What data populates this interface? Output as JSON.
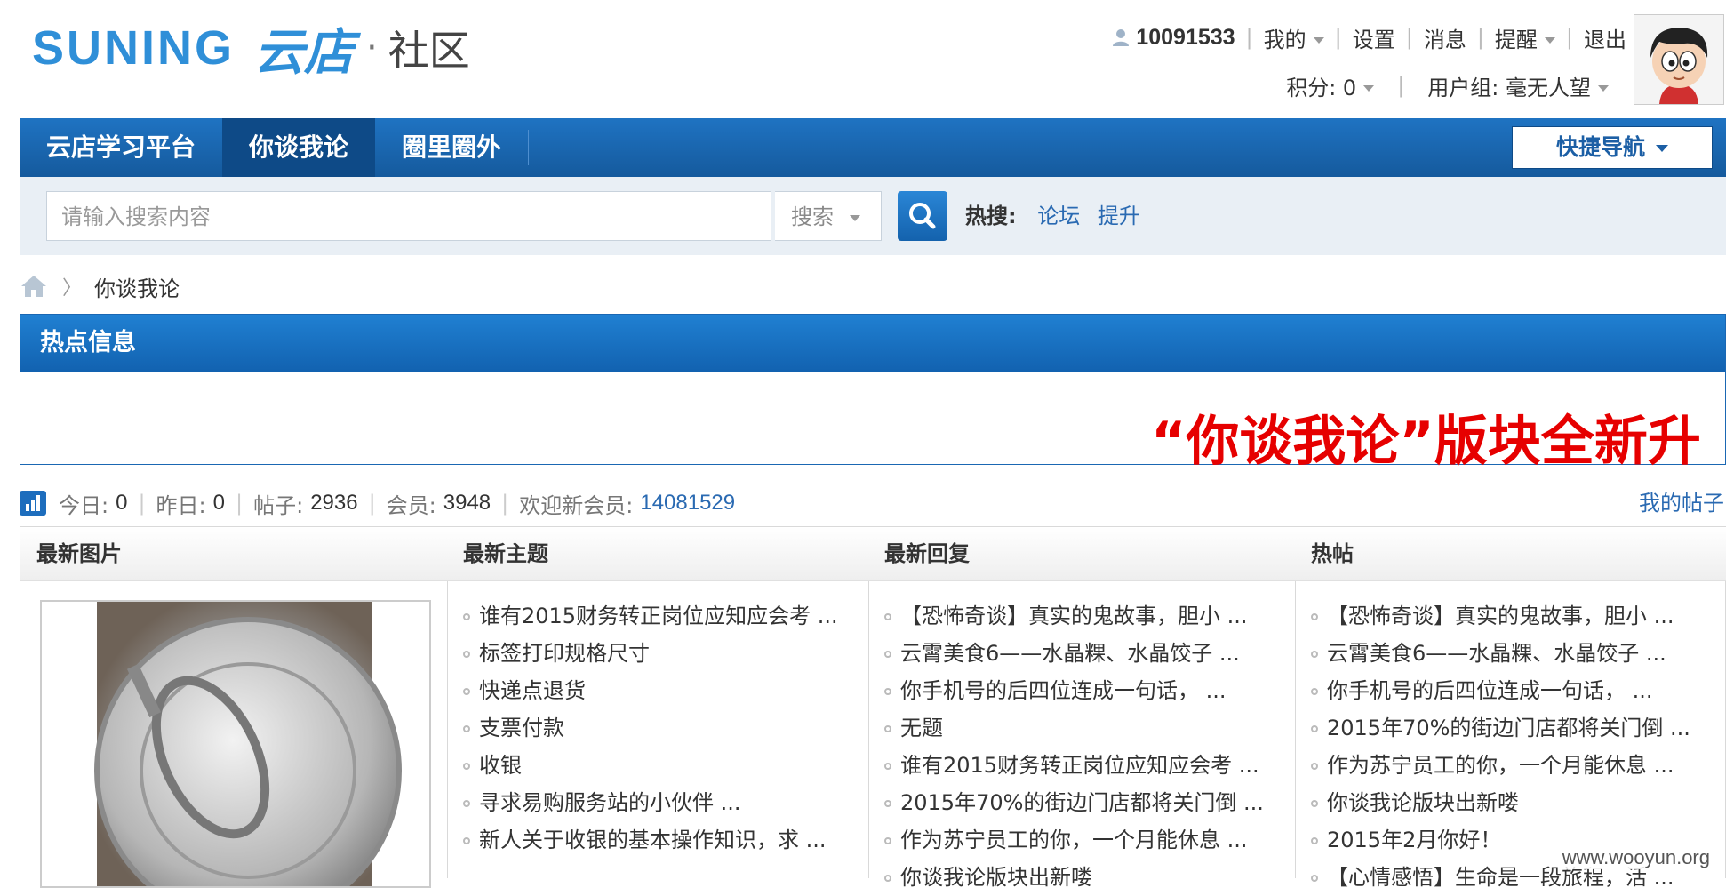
{
  "logo": {
    "brand": "SUNING",
    "product": "云店",
    "dot": "·",
    "section": "社区"
  },
  "topbar": {
    "user_id": "10091533",
    "mine": "我的",
    "settings": "设置",
    "messages": "消息",
    "reminders": "提醒",
    "logout": "退出",
    "points_label": "积分: 0",
    "usergroup_label": "用户组: 毫无人望"
  },
  "nav": {
    "tabs": [
      {
        "label": "云店学习平台"
      },
      {
        "label": "你谈我论"
      },
      {
        "label": "圈里圈外"
      }
    ],
    "quick_nav": "快捷导航"
  },
  "search": {
    "placeholder": "请输入搜索内容",
    "select": "搜索",
    "hot_label": "热搜:",
    "hot_terms": [
      "论坛",
      "提升"
    ]
  },
  "breadcrumb": {
    "current": "你谈我论",
    "sep": "〉"
  },
  "hot_info": {
    "title": "热点信息",
    "marquee": "“你谈我论”版块全新升"
  },
  "stats": {
    "today_label": "今日:",
    "today": "0",
    "yesterday_label": "昨日:",
    "yesterday": "0",
    "posts_label": "帖子:",
    "posts": "2936",
    "members_label": "会员:",
    "members": "3948",
    "welcome_label": "欢迎新会员:",
    "newest_member": "14081529",
    "my_posts": "我的帖子"
  },
  "columns": {
    "photos": {
      "title": "最新图片"
    },
    "latest_topics": {
      "title": "最新主题",
      "items": [
        "谁有2015财务转正岗位应知应会考 ...",
        "标签打印规格尺寸",
        "快递点退货",
        "支票付款",
        "收银",
        "寻求易购服务站的小伙伴 ...",
        "新人关于收银的基本操作知识，求 ..."
      ]
    },
    "latest_replies": {
      "title": "最新回复",
      "items": [
        "【恐怖奇谈】真实的鬼故事，胆小 ...",
        "云霄美食6——水晶粿、水晶饺子 ...",
        "你手机号的后四位连成一句话， ...",
        "无题",
        "谁有2015财务转正岗位应知应会考 ...",
        "2015年70%的街边门店都将关门倒 ...",
        "作为苏宁员工的你，一个月能休息 ...",
        "你谈我论版块出新喽"
      ]
    },
    "hot_posts": {
      "title": "热帖",
      "items": [
        "【恐怖奇谈】真实的鬼故事，胆小 ...",
        "云霄美食6——水晶粿、水晶饺子 ...",
        "你手机号的后四位连成一句话， ...",
        "2015年70%的街边门店都将关门倒 ...",
        "作为苏宁员工的你，一个月能休息 ...",
        "你谈我论版块出新喽",
        "2015年2月你好！",
        "【心情感悟】生命是一段旅程，活 ..."
      ]
    }
  },
  "watermark": "www.wooyun.org",
  "colors": {
    "nav_blue": "#1f73c2",
    "link_blue": "#2a6ab2",
    "alert_red": "#e60000"
  }
}
